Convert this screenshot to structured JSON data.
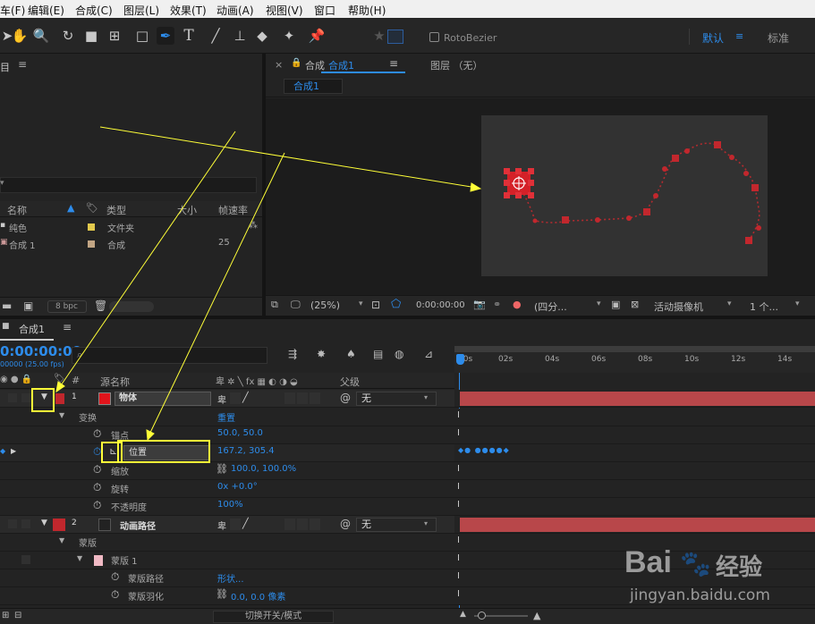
{
  "menu": [
    "车(F)",
    "编辑(E)",
    "合成(C)",
    "图层(L)",
    "效果(T)",
    "动画(A)",
    "视图(V)",
    "窗口",
    "帮助(H)"
  ],
  "toolbar": {
    "rotobezier": "RotoBezier",
    "workspace_default": "默认",
    "workspace_standard": "标准"
  },
  "project": {
    "title": "目",
    "cols": {
      "name": "名称",
      "type": "类型",
      "size": "大小",
      "fps": "帧速率"
    },
    "items": [
      {
        "name": "纯色",
        "type": "文件夹",
        "fps": "",
        "color": "#e3c94c"
      },
      {
        "name": "合成 1",
        "type": "合成",
        "fps": "25",
        "color": "#c2a584"
      }
    ],
    "bpc": "8 bpc"
  },
  "viewer": {
    "tab_prefix": "合成",
    "tab_name": "合成1",
    "layer_panel": "图层 （无）",
    "breadcrumb": "合成1",
    "zoom": "(25%)",
    "timecode": "0:00:00:00",
    "view_mode": "(四分...",
    "camera": "活动摄像机",
    "views": "1 个..."
  },
  "timeline": {
    "tab": "合成1",
    "time": "0:00:00:00",
    "fps": "00000 (25.00 fps)",
    "ruler": [
      "00s",
      "02s",
      "04s",
      "06s",
      "08s",
      "10s",
      "12s",
      "14s"
    ],
    "headers": {
      "num": "#",
      "source": "源名称",
      "parent": "父级"
    },
    "layers": {
      "l1": {
        "num": "1",
        "name": "物体",
        "parent": "无"
      },
      "transform": "变换",
      "reset": "重置",
      "anchor": {
        "label": "锚点",
        "value": "50.0, 50.0"
      },
      "position": {
        "label": "位置",
        "value": "167.2, 305.4"
      },
      "scale": {
        "label": "缩放",
        "value": "100.0, 100.0%"
      },
      "rotation": {
        "label": "旋转",
        "value": "0x +0.0°"
      },
      "opacity": {
        "label": "不透明度",
        "value": "100%"
      },
      "l2": {
        "num": "2",
        "name": "动画路径",
        "parent": "无"
      },
      "masks": "蒙版",
      "mask1": "蒙版 1",
      "mask_path": {
        "label": "蒙版路径",
        "value": "形状..."
      },
      "mask_feather": {
        "label": "蒙版羽化",
        "value": "0.0, 0.0 像素"
      }
    },
    "bottom": "切换开关/模式"
  },
  "watermark": {
    "brand": "Bai",
    "brand2": "经验",
    "url": "jingyan.baidu.com"
  },
  "colors": {
    "accent": "#2d8ceb",
    "layer_red": "#c0272d",
    "annotation": "#ffff38"
  }
}
